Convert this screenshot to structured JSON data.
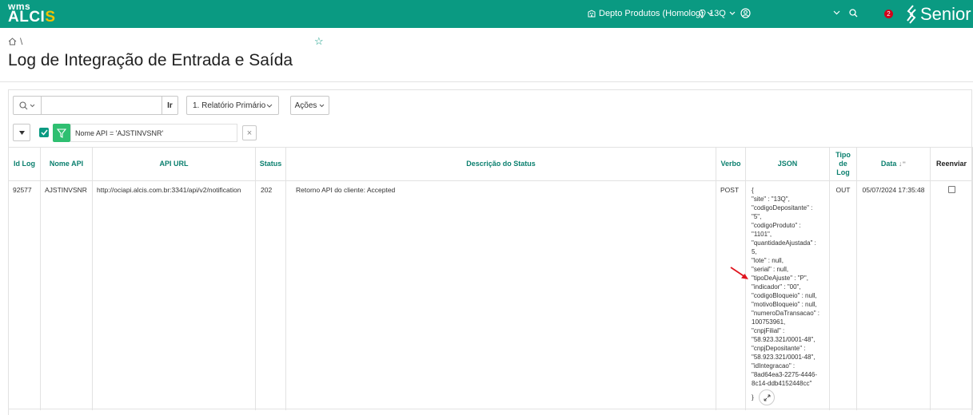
{
  "header": {
    "logo_top": "wms",
    "logo_main": "ALCI",
    "logo_accent": "S",
    "depot": "Depto Produtos (Homolog)",
    "site": "13Q",
    "notifications_count": "2",
    "brand": "Senior"
  },
  "breadcrumb": {
    "separator": "\\"
  },
  "page": {
    "title": "Log de Integração de Entrada e Saída"
  },
  "toolbar": {
    "search_value": "",
    "go_label": "Ir",
    "report_select": "1. Relatório Primário",
    "actions_label": "Ações"
  },
  "filter": {
    "text": "Nome API = 'AJSTINVSNR'",
    "remove_label": "×"
  },
  "table": {
    "columns": {
      "id_log": "Id Log",
      "nome_api": "Nome API",
      "api_url": "API URL",
      "status": "Status",
      "descricao": "Descrição do Status",
      "verbo": "Verbo",
      "json": "JSON",
      "tipo_log": "Tipo de Log",
      "data": "Data",
      "reenviar": "Reenviar"
    },
    "rows": [
      {
        "id_log": "92577",
        "nome_api": "AJSTINVSNR",
        "api_url": "http://ociapi.alcis.com.br:3341/api/v2/notification",
        "status": "202",
        "descricao": "Retorno API do cliente: Accepted",
        "verbo": "POST",
        "json": "{\n\"site\" : \"13Q\",\n\"codigoDepositante\" :\n\"5\",\n\"codigoProduto\" :\n\"1101\",\n\"quantidadeAjustada\" :\n5,\n\"lote\" : null,\n\"serial\" : null,\n\"tipoDeAjuste\" : \"P\",\n\"indicador\" : \"00\",\n\"codigoBloqueio\" : null,\n\"motivoBloqueio\" : null,\n\"numeroDaTransacao\" :\n100753961,\n\"cnpjFilial\" :\n\"58.923.321/0001-48\",\n\"cnpjDepositante\" :\n\"58.923.321/0001-48\",\n\"idIntegracao\" :\n\"8ad64ea3-2275-4446-\n8c14-ddb4152448cc\"",
        "json_close": "}",
        "tipo_log": "OUT",
        "data": "05/07/2024 17:35:48"
      }
    ]
  },
  "colors": {
    "header_bg": "#0a9a82",
    "accent_green": "#2fbf71",
    "logo_yellow": "#f2c200",
    "badge_red": "#d0021b",
    "arrow_red": "#e0141e"
  }
}
